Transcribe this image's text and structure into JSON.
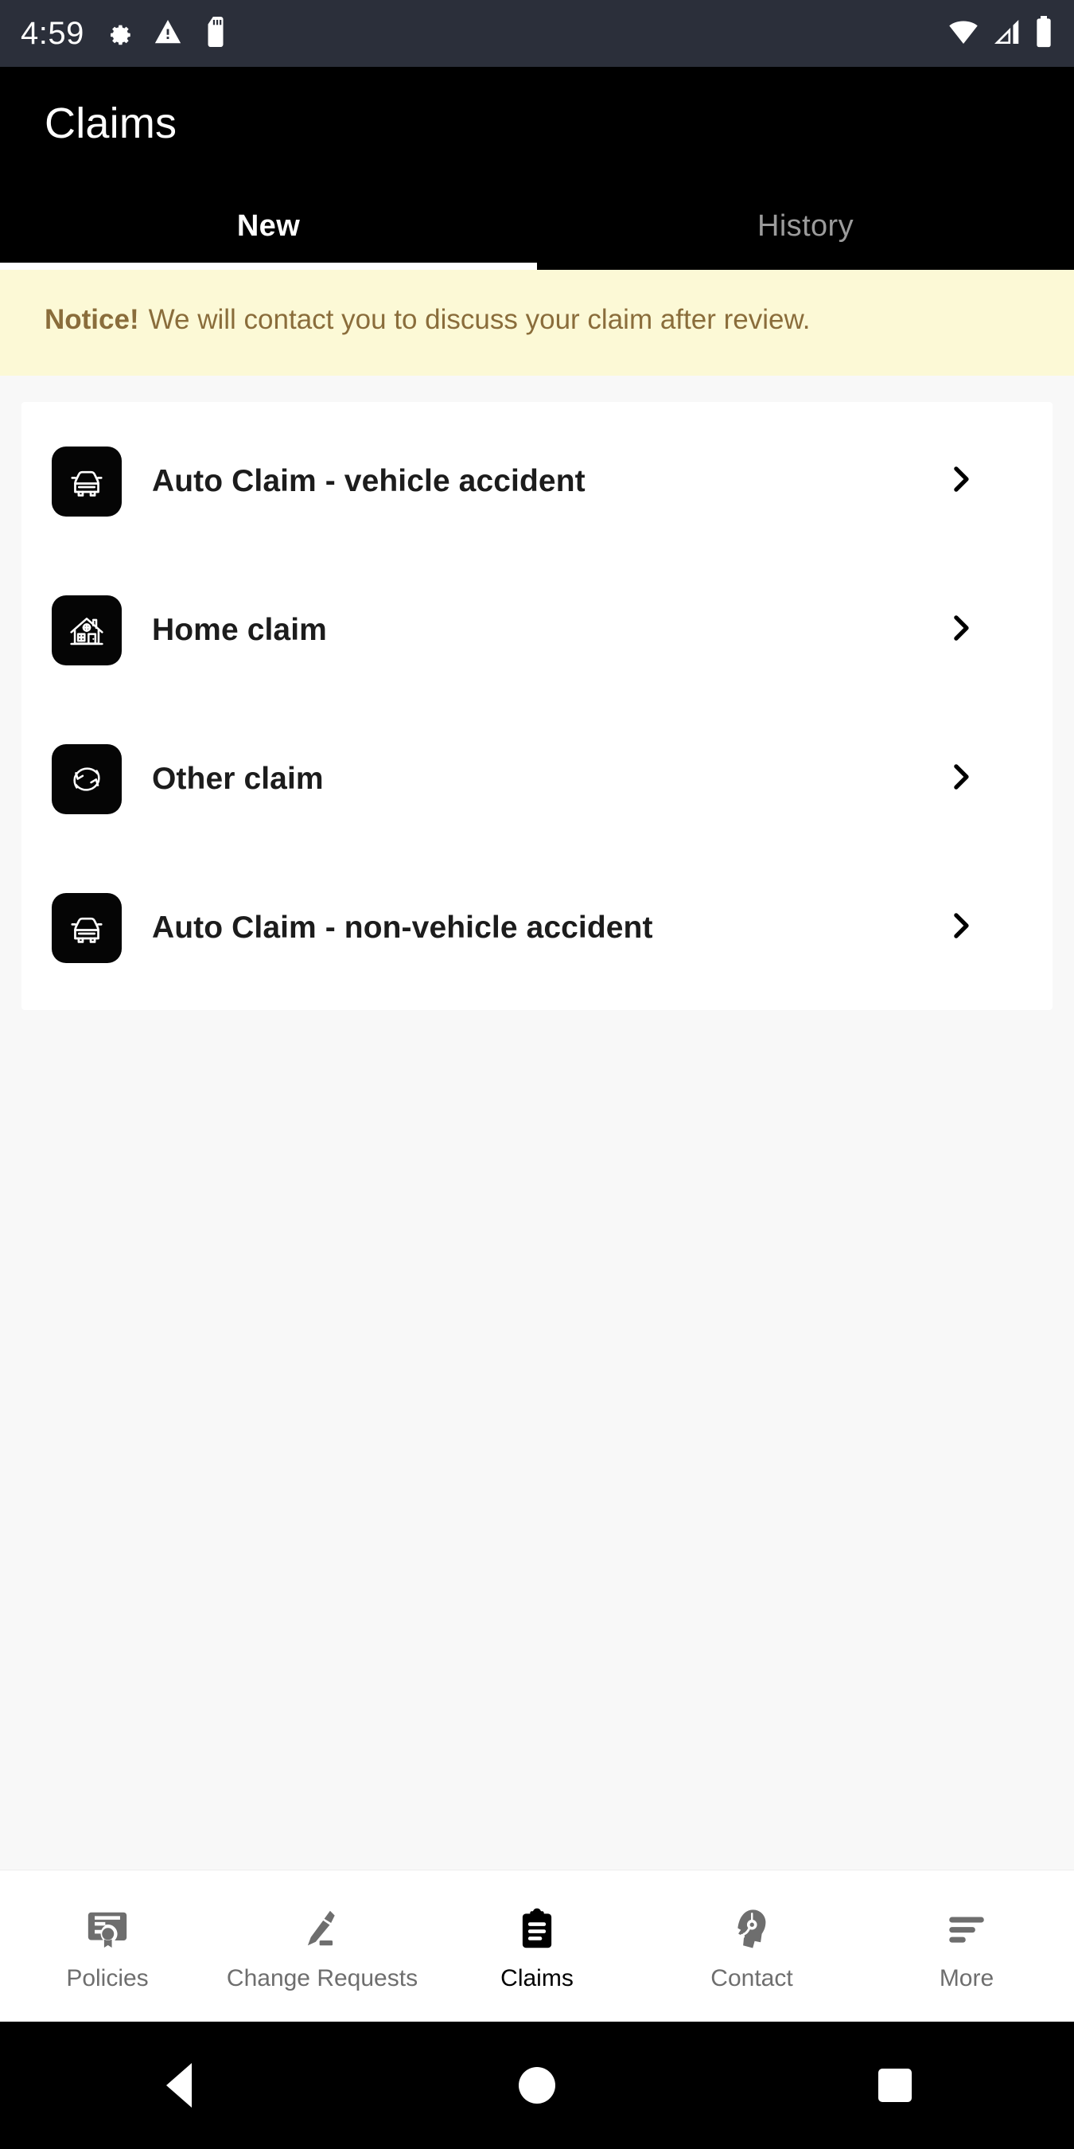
{
  "status_bar": {
    "time": "4:59",
    "left_icons": [
      "gear-icon",
      "warning-triangle-icon",
      "sd-card-icon"
    ],
    "right_icons": [
      "wifi-icon",
      "cellular-signal-icon",
      "battery-icon"
    ]
  },
  "app_bar": {
    "title": "Claims"
  },
  "tabs": [
    {
      "label": "New",
      "active": true
    },
    {
      "label": "History",
      "active": false
    }
  ],
  "notice": {
    "strong": "Notice!",
    "message": "We will contact you to discuss your claim after review.",
    "background_color": "#FCF9D6",
    "text_color": "#8A6D3B"
  },
  "claims": [
    {
      "label": "Auto Claim - vehicle accident",
      "icon": "car-front-icon"
    },
    {
      "label": "Home claim",
      "icon": "house-icon"
    },
    {
      "label": "Other claim",
      "icon": "circular-arrows-icon"
    },
    {
      "label": "Auto Claim - non-vehicle accident",
      "icon": "car-front-icon"
    }
  ],
  "bottom_nav": [
    {
      "label": "Policies",
      "icon": "certificate-icon",
      "active": false
    },
    {
      "label": "Change Requests",
      "icon": "pencil-icon",
      "active": false
    },
    {
      "label": "Claims",
      "icon": "clipboard-icon",
      "active": true
    },
    {
      "label": "Contact",
      "icon": "headset-person-icon",
      "active": false
    },
    {
      "label": "More",
      "icon": "hamburger-lines-icon",
      "active": false
    }
  ],
  "android_nav": {
    "back": "back-triangle-icon",
    "home": "home-circle-icon",
    "recents": "recents-square-icon"
  },
  "colors": {
    "app_bar": "#000000",
    "status_bar": "#2B2F3A",
    "page_background": "#F8F8F8",
    "card": "#FFFFFF",
    "active_nav": "#000000",
    "inactive_nav": "#6E6E6E"
  }
}
